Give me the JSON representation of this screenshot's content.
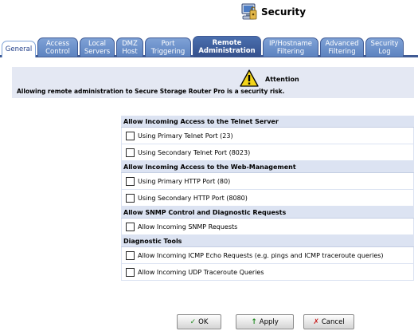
{
  "header": {
    "title": "Security"
  },
  "tabs": [
    {
      "label": "General"
    },
    {
      "label": "Access\nControl"
    },
    {
      "label": "Local\nServers"
    },
    {
      "label": "DMZ\nHost"
    },
    {
      "label": "Port\nTriggering"
    },
    {
      "label": "Remote\nAdministration"
    },
    {
      "label": "IP/Hostname\nFiltering"
    },
    {
      "label": "Advanced\nFiltering"
    },
    {
      "label": "Security\nLog"
    }
  ],
  "active_tab": "Remote Administration",
  "attention": {
    "label": "Attention",
    "message": "Allowing remote administration to Secure Storage Router Pro is a security risk."
  },
  "sections": [
    {
      "title": "Allow Incoming Access to the Telnet Server",
      "options": [
        {
          "label": "Using Primary Telnet Port (23)",
          "checked": false
        },
        {
          "label": "Using Secondary Telnet Port (8023)",
          "checked": false
        }
      ]
    },
    {
      "title": "Allow Incoming Access to the Web-Management",
      "options": [
        {
          "label": "Using Primary HTTP Port (80)",
          "checked": false
        },
        {
          "label": "Using Secondary HTTP Port (8080)",
          "checked": false
        }
      ]
    },
    {
      "title": "Allow SNMP Control and Diagnostic Requests",
      "options": [
        {
          "label": "Allow Incoming SNMP Requests",
          "checked": false
        }
      ]
    },
    {
      "title": "Diagnostic Tools",
      "options": [
        {
          "label": "Allow Incoming ICMP Echo Requests (e.g. pings and ICMP traceroute queries)",
          "checked": false
        },
        {
          "label": "Allow Incoming UDP Traceroute Queries",
          "checked": false
        }
      ]
    }
  ],
  "buttons": {
    "ok": {
      "label": "OK",
      "icon": "checkmark-icon",
      "color": "#1f8a1f"
    },
    "apply": {
      "label": "Apply",
      "icon": "arrow-up-icon",
      "color": "#1f8a1f"
    },
    "cancel": {
      "label": "Cancel",
      "icon": "x-icon",
      "color": "#c81e1e"
    }
  }
}
